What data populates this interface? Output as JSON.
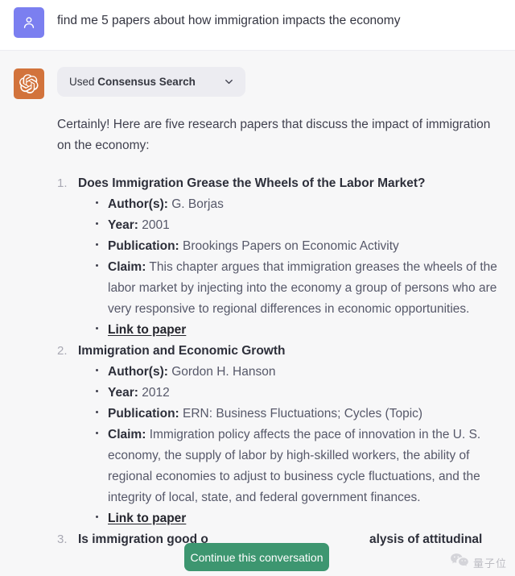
{
  "conversation": {
    "user_message": {
      "avatar_icon": "person-icon",
      "avatar_color": "#7b7ff0",
      "text": "find me 5 papers about how immigration impacts the economy"
    },
    "assistant_message": {
      "avatar_icon": "openai-logo-icon",
      "avatar_color": "#d2733c",
      "tool_pill": {
        "lead_label": "Used",
        "tool_name": "Consensus Search",
        "expand_icon": "chevron-down-icon"
      },
      "intro": "Certainly! Here are five research papers that discuss the impact of immigration on the economy:",
      "field_labels": {
        "authors": "Author(s):",
        "year": "Year:",
        "publication": "Publication:",
        "claim": "Claim:"
      },
      "link_label": "Link to paper",
      "papers": [
        {
          "number": "1.",
          "title": "Does Immigration Grease the Wheels of the Labor Market?",
          "authors": "G. Borjas",
          "year": "2001",
          "publication": "Brookings Papers on Economic Activity",
          "claim": "This chapter argues that immigration greases the wheels of the labor market by injecting into the economy a group of persons who are very responsive to regional differences in economic opportunities."
        },
        {
          "number": "2.",
          "title": "Immigration and Economic Growth",
          "authors": "Gordon H. Hanson",
          "year": "2012",
          "publication": "ERN: Business Fluctuations; Cycles (Topic)",
          "claim": "Immigration policy affects the pace of innovation in the U. S. economy, the supply of labor by high-skilled workers, the ability of regional economies to adjust to business cycle fluctuations, and the integrity of local, state, and federal government finances."
        },
        {
          "number": "3.",
          "title_visible_start": "Is immigration good o",
          "title_visible_end": "alysis of attitudinal"
        }
      ]
    }
  },
  "overlay": {
    "cta_label": "Continue this conversation",
    "cta_color": "#3d9670"
  },
  "watermark": {
    "icon": "wechat-icon",
    "text": "量子位"
  }
}
